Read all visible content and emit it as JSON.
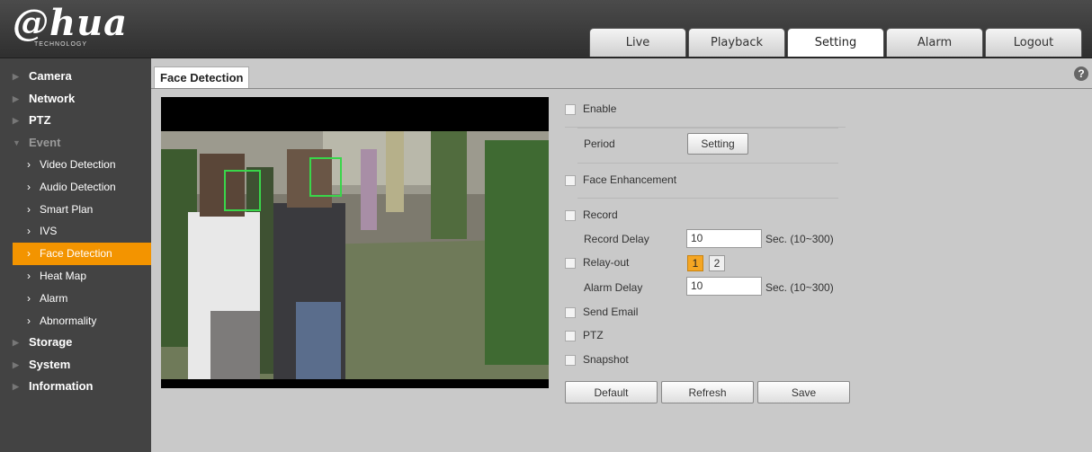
{
  "brand": {
    "logo": "@hua",
    "sub": "TECHNOLOGY"
  },
  "tabs": [
    {
      "label": "Live"
    },
    {
      "label": "Playback"
    },
    {
      "label": "Setting"
    },
    {
      "label": "Alarm"
    },
    {
      "label": "Logout"
    }
  ],
  "sidebar": {
    "sections": [
      {
        "label": "Camera"
      },
      {
        "label": "Network"
      },
      {
        "label": "PTZ"
      },
      {
        "label": "Event"
      }
    ],
    "event_items": [
      {
        "label": "Video Detection"
      },
      {
        "label": "Audio Detection"
      },
      {
        "label": "Smart Plan"
      },
      {
        "label": "IVS"
      },
      {
        "label": "Face Detection"
      },
      {
        "label": "Heat Map"
      },
      {
        "label": "Alarm"
      },
      {
        "label": "Abnormality"
      }
    ],
    "after": [
      {
        "label": "Storage"
      },
      {
        "label": "System"
      },
      {
        "label": "Information"
      }
    ]
  },
  "page": {
    "tab": "Face Detection",
    "help": "?"
  },
  "form": {
    "enable": "Enable",
    "period": "Period",
    "period_btn": "Setting",
    "face_enh": "Face Enhancement",
    "record": "Record",
    "record_delay": "Record Delay",
    "record_delay_val": "10",
    "record_delay_unit": "Sec. (10~300)",
    "relay_out": "Relay-out",
    "relay_1": "1",
    "relay_2": "2",
    "alarm_delay": "Alarm Delay",
    "alarm_delay_val": "10",
    "alarm_delay_unit": "Sec. (10~300)",
    "send_email": "Send Email",
    "ptz": "PTZ",
    "snapshot": "Snapshot",
    "default_btn": "Default",
    "refresh_btn": "Refresh",
    "save_btn": "Save"
  }
}
